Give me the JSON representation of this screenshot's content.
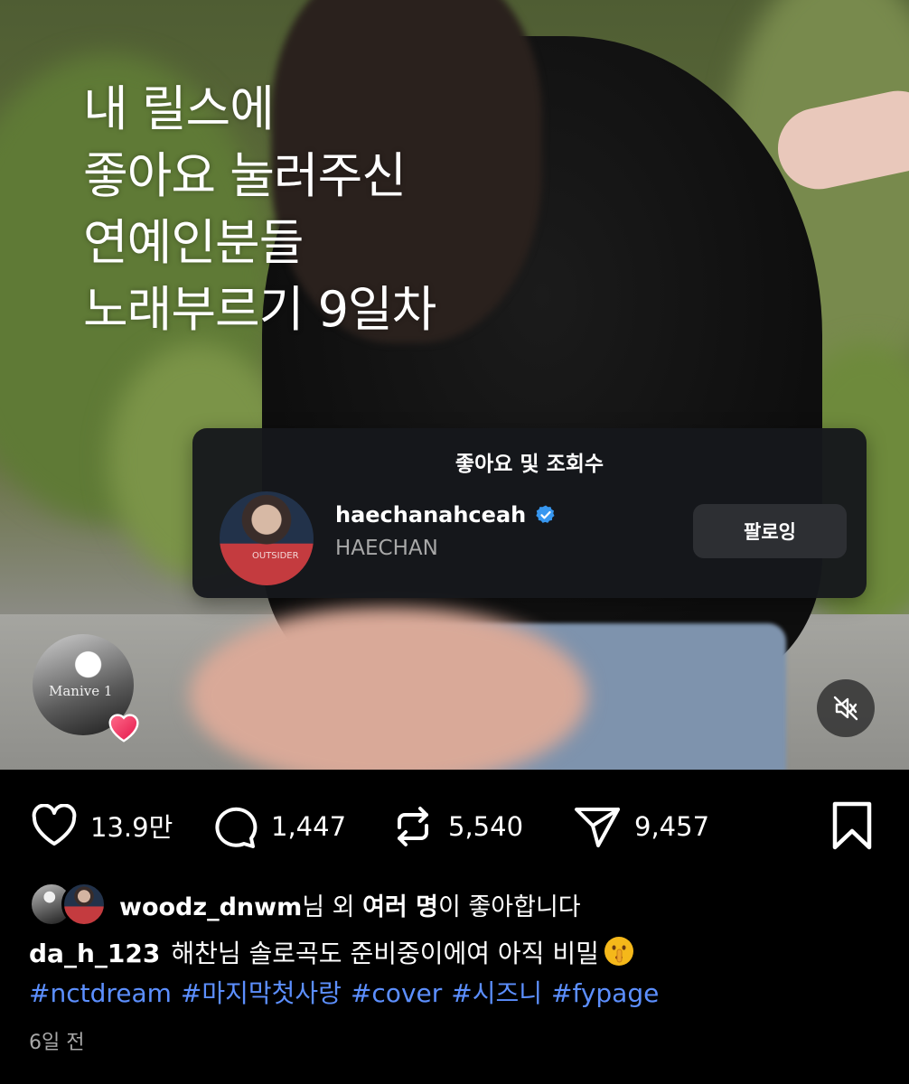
{
  "reel": {
    "overlay_lines": [
      "내 릴스에",
      "좋아요 눌러주신",
      "연예인분들",
      "노래부르기 9일차"
    ],
    "audio_avatar_text": "Manive 1",
    "mute_icon": "speaker-muted-icon"
  },
  "likes_popup": {
    "title": "좋아요 및 조회수",
    "username": "haechanahceah",
    "verified": true,
    "full_name": "HAECHAN",
    "avatar_shirt_text": "OUTSIDER",
    "follow_button_label": "팔로잉"
  },
  "actions": {
    "likes": "13.9만",
    "comments": "1,447",
    "reposts": "5,540",
    "shares": "9,457"
  },
  "liked_by": {
    "username": "woodz_dnwm",
    "suffix1": "님 외 ",
    "emphasis": "여러 명",
    "suffix2": "이 좋아합니다"
  },
  "caption": {
    "username": "da_h_123",
    "text": "해찬님 솔로곡도 준비중이에여 아직 비밀",
    "emoji": "shushing-face"
  },
  "hashtags": [
    "#nctdream",
    "#마지막첫사랑",
    "#cover",
    "#시즈니",
    "#fypage"
  ],
  "timestamp": "6일 전",
  "colors": {
    "background": "#000000",
    "hashtag": "#5c8fff",
    "verified": "#3797f0",
    "popup_bg": "#16181c",
    "secondary_text": "#a8a8a8"
  }
}
